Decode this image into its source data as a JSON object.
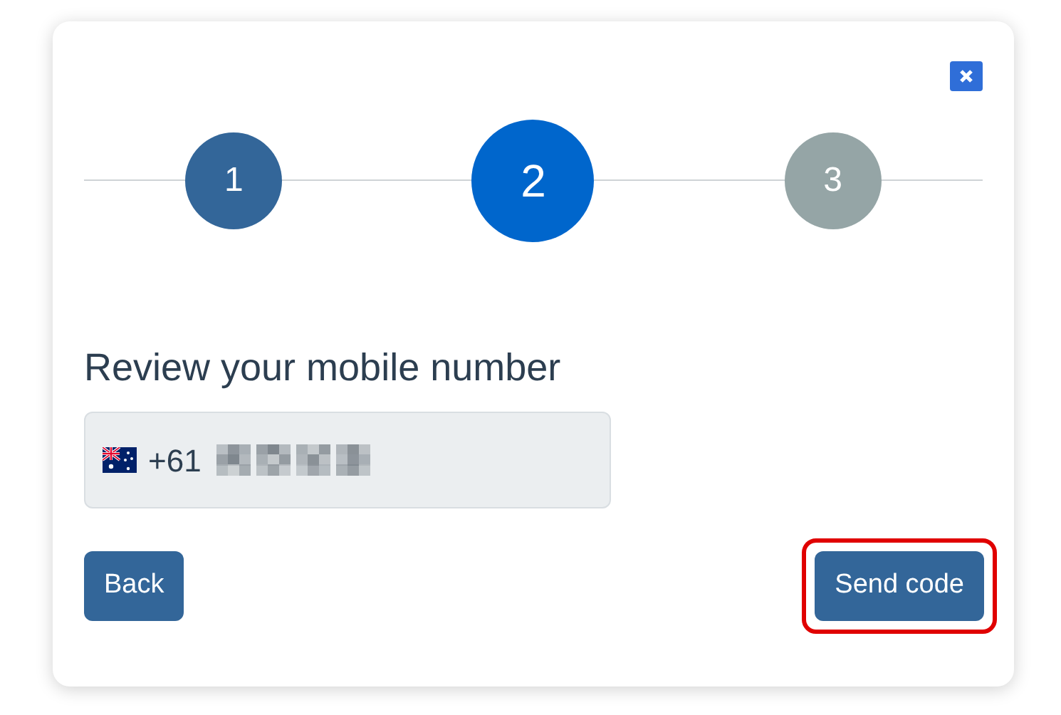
{
  "steps": [
    {
      "label": "1",
      "kind": "done"
    },
    {
      "label": "2",
      "kind": "current"
    },
    {
      "label": "3",
      "kind": "upcoming"
    }
  ],
  "heading": "Review your mobile number",
  "phone_field": {
    "country_code": "+61"
  },
  "buttons": [
    {
      "label": "Back",
      "highlighted": false
    },
    {
      "label": "Send code",
      "highlighted": true
    }
  ]
}
